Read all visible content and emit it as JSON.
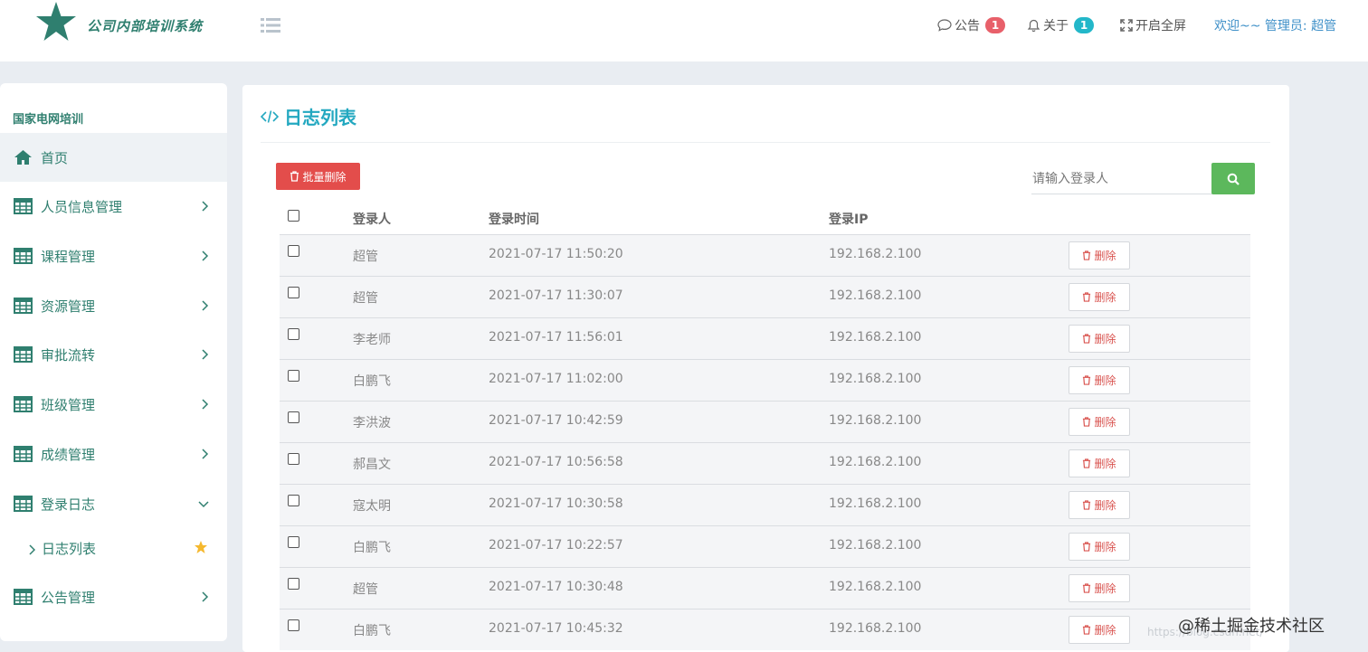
{
  "header": {
    "logo_text": "公司内部培训系统",
    "announcement_label": "公告",
    "announcement_count": "1",
    "about_label": "关于",
    "about_count": "1",
    "fullscreen_label": "开启全屏",
    "welcome_text": "欢迎~~ 管理员: 超管"
  },
  "sidebar": {
    "title": "国家电网培训",
    "items": [
      {
        "label": "首页",
        "icon": "home-icon",
        "active": true
      },
      {
        "label": "人员信息管理",
        "icon": "table-icon"
      },
      {
        "label": "课程管理",
        "icon": "table-icon"
      },
      {
        "label": "资源管理",
        "icon": "table-icon"
      },
      {
        "label": "审批流转",
        "icon": "table-icon"
      },
      {
        "label": "班级管理",
        "icon": "table-icon"
      },
      {
        "label": "成绩管理",
        "icon": "table-icon"
      },
      {
        "label": "登录日志",
        "icon": "table-icon",
        "expanded": true
      },
      {
        "label": "公告管理",
        "icon": "table-icon"
      }
    ],
    "sub_item": {
      "label": "日志列表",
      "icon": "star-icon"
    }
  },
  "main": {
    "title": "日志列表",
    "batch_delete_label": "批量删除",
    "search_placeholder": "请输入登录人",
    "columns": [
      "登录人",
      "登录时间",
      "登录IP"
    ],
    "delete_label": "删除",
    "rows": [
      {
        "user": "超管",
        "time": "2021-07-17 11:50:20",
        "ip": "192.168.2.100"
      },
      {
        "user": "超管",
        "time": "2021-07-17 11:30:07",
        "ip": "192.168.2.100"
      },
      {
        "user": "李老师",
        "time": "2021-07-17 11:56:01",
        "ip": "192.168.2.100"
      },
      {
        "user": "白鹏飞",
        "time": "2021-07-17 11:02:00",
        "ip": "192.168.2.100"
      },
      {
        "user": "李洪波",
        "time": "2021-07-17 10:42:59",
        "ip": "192.168.2.100"
      },
      {
        "user": "郝昌文",
        "time": "2021-07-17 10:56:58",
        "ip": "192.168.2.100"
      },
      {
        "user": "寇太明",
        "time": "2021-07-17 10:30:58",
        "ip": "192.168.2.100"
      },
      {
        "user": "白鹏飞",
        "time": "2021-07-17 10:22:57",
        "ip": "192.168.2.100"
      },
      {
        "user": "超管",
        "time": "2021-07-17 10:30:48",
        "ip": "192.168.2.100"
      },
      {
        "user": "白鹏飞",
        "time": "2021-07-17 10:45:32",
        "ip": "192.168.2.100"
      }
    ]
  },
  "watermark": "@稀土掘金技术社区",
  "colors": {
    "brand_green": "#2f7f6f",
    "title_cyan": "#23a8c0",
    "danger": "#e34d4b",
    "search_green": "#5cb85c"
  }
}
